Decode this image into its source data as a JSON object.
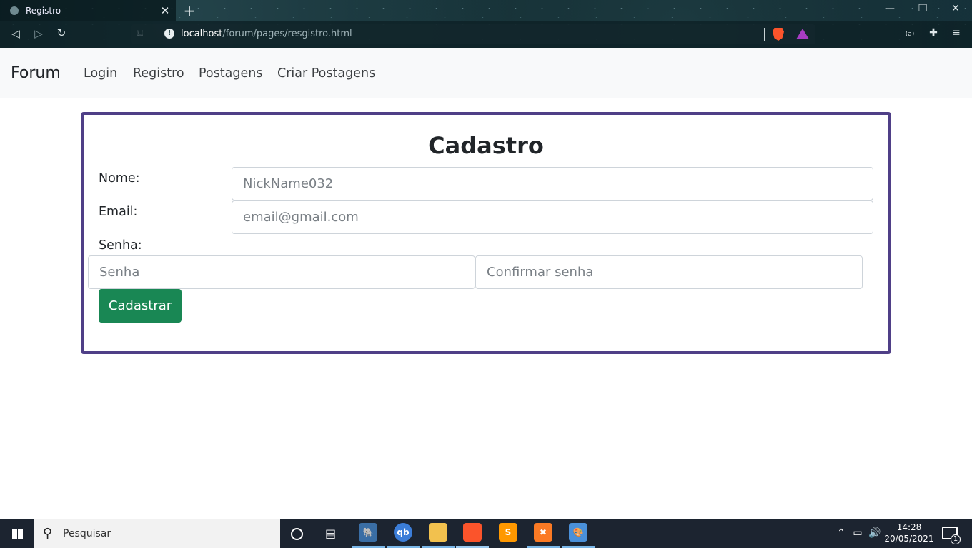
{
  "browser": {
    "tab_title": "Registro",
    "tab_close": "✕",
    "new_tab": "+",
    "url_host": "localhost",
    "url_path": "/forum/pages/resgistro.html",
    "window_controls": {
      "minimize": "—",
      "maximize": "❐",
      "close": "✕"
    }
  },
  "navbar": {
    "brand": "Forum",
    "links": [
      "Login",
      "Registro",
      "Postagens",
      "Criar Postagens"
    ]
  },
  "form": {
    "title": "Cadastro",
    "name_label": "Nome:",
    "name_placeholder": "NickName032",
    "email_label": "Email:",
    "email_placeholder": "email@gmail.com",
    "password_label": "Senha:",
    "password_placeholder": "Senha",
    "confirm_placeholder": "Confirmar senha",
    "submit_label": "Cadastrar"
  },
  "taskbar": {
    "search_placeholder": "Pesquisar",
    "time": "14:28",
    "date": "20/05/2021",
    "notification_count": "1",
    "apps": [
      {
        "icon": "pgadmin-icon",
        "text": "🐘",
        "color": "#3a6ea5"
      },
      {
        "icon": "qbittorrent-icon",
        "text": "qb",
        "color": "#3b7dd8"
      },
      {
        "icon": "file-explorer-icon",
        "text": "",
        "color": "#f2c14e"
      },
      {
        "icon": "brave-icon",
        "text": "",
        "color": "#fb542b"
      },
      {
        "icon": "sublime-text-icon",
        "text": "S",
        "color": "#ff9800"
      },
      {
        "icon": "xampp-icon",
        "text": "✖",
        "color": "#fb7a24"
      },
      {
        "icon": "paint-icon",
        "text": "🎨",
        "color": "#4a90d9"
      }
    ]
  },
  "colors": {
    "card_border": "#4f3f87",
    "submit_button": "#198754",
    "navbar_bg": "#f8f9fa",
    "taskbar_bg": "#1c2430"
  }
}
